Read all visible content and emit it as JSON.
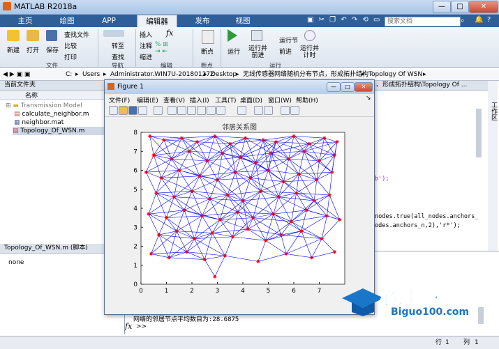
{
  "window": {
    "title": "MATLAB R2018a",
    "minimize": "—",
    "maximize": "□",
    "close": "✕"
  },
  "tabs": [
    {
      "label": "主页"
    },
    {
      "label": "绘图"
    },
    {
      "label": "APP"
    },
    {
      "label": "编辑器"
    },
    {
      "label": "发布"
    },
    {
      "label": "视图"
    }
  ],
  "search": {
    "placeholder": "搜索文档"
  },
  "ribbon": {
    "new": "新建",
    "open": "打开",
    "save": "保存",
    "find_files": "查找文件",
    "compare": "比较",
    "print": "打印",
    "goto": "转至",
    "find": "查找",
    "insert": "插入",
    "comment": "注释",
    "indent": "缩进",
    "fx": "fx",
    "breakpoints": "断点",
    "run": "运行",
    "run_advance": "运行并\n前进",
    "run_section": "运行节",
    "advance": "前进",
    "run_time": "运行并\n计时",
    "groups": {
      "file": "文件",
      "navigate": "导航",
      "edit": "编辑",
      "breakpoints": "断点",
      "run": "运行"
    }
  },
  "address": {
    "path": [
      "C:",
      "Users",
      "Administrator.WIN7U-20180127Z",
      "Desktop",
      "无线传感器网络随机分布节点，形成拓扑结构",
      "Topology Of WSN"
    ]
  },
  "current_folder": {
    "header": "当前文件夹",
    "column": "名称",
    "items": [
      {
        "name": "Transmission Model",
        "type": "folder"
      },
      {
        "name": "calculate_neighbor.m",
        "type": "m"
      },
      {
        "name": "neighbor.mat",
        "type": "mat"
      },
      {
        "name": "Topology_Of_WSN.m",
        "type": "m",
        "selected": true
      }
    ]
  },
  "details": {
    "header": "Topology_Of_WSN.m  (脚本)",
    "content": "none"
  },
  "editor": {
    "tab_path": "、形成拓扑结构\\Topology Of ...",
    "line1": "b');",
    "line2": "nodes.true(all_nodes.anchors_",
    "line3": "odes.anchors_n,2),'r*');"
  },
  "workspace_label": "工作区",
  "command": {
    "output": "网络的邻居节点平均数目为:28.6875",
    "prompt": ">>",
    "fx": "fx"
  },
  "status": {
    "row_label": "行",
    "row": "1",
    "col_label": "列",
    "col": "1"
  },
  "figure": {
    "title": "Figure 1",
    "menu": [
      "文件(F)",
      "编辑(E)",
      "查看(V)",
      "插入(I)",
      "工具(T)",
      "桌面(D)",
      "窗口(W)",
      "帮助(H)"
    ]
  },
  "watermark": {
    "text": "必过源码",
    "url": "Biguo100.com"
  },
  "colors": {
    "edge": "#0000ff",
    "node": "#ff0000",
    "tabbar": "#2f5f99"
  },
  "chart_data": {
    "type": "scatter",
    "title": "邻居关系图",
    "xlim": [
      0,
      8
    ],
    "ylim": [
      0,
      8
    ],
    "xticks": [
      0,
      1,
      2,
      3,
      4,
      5,
      6,
      7
    ],
    "yticks": [
      0,
      1,
      2,
      3,
      4,
      5,
      6,
      7,
      8
    ],
    "x": [
      0.35,
      0.9,
      1.6,
      2.2,
      2.9,
      3.5,
      4.1,
      4.8,
      5.3,
      6.0,
      6.6,
      7.2,
      7.7,
      0.5,
      1.2,
      1.9,
      2.6,
      3.2,
      3.9,
      4.5,
      5.1,
      5.8,
      6.4,
      7.0,
      7.6,
      0.2,
      0.8,
      1.5,
      2.3,
      3.0,
      3.7,
      4.3,
      5.0,
      5.6,
      6.2,
      6.9,
      7.5,
      0.6,
      1.3,
      2.0,
      2.7,
      3.4,
      4.0,
      4.7,
      5.4,
      6.1,
      6.8,
      7.4,
      0.3,
      1.0,
      1.7,
      2.4,
      3.1,
      3.8,
      4.4,
      5.2,
      5.9,
      6.5,
      7.3,
      7.8,
      0.7,
      1.4,
      2.1,
      2.8,
      3.6,
      4.2,
      4.9,
      5.5,
      6.3,
      7.1,
      0.4,
      1.1,
      1.8,
      2.5,
      3.3,
      4.6,
      5.7,
      6.7,
      7.6,
      2.9
    ],
    "y": [
      7.8,
      7.6,
      7.7,
      7.5,
      7.8,
      7.4,
      7.7,
      7.6,
      7.5,
      7.8,
      7.4,
      7.7,
      7.5,
      6.8,
      6.6,
      7.0,
      6.5,
      6.9,
      6.7,
      6.4,
      6.9,
      6.6,
      7.0,
      6.5,
      6.8,
      5.9,
      5.6,
      6.0,
      5.7,
      5.5,
      5.9,
      5.6,
      6.0,
      5.4,
      5.8,
      5.5,
      5.9,
      4.8,
      4.6,
      4.9,
      4.5,
      4.7,
      4.4,
      4.9,
      4.6,
      4.8,
      4.4,
      4.7,
      3.7,
      3.5,
      3.9,
      3.6,
      3.4,
      3.8,
      3.5,
      3.7,
      3.3,
      3.9,
      3.6,
      3.4,
      2.6,
      2.8,
      2.4,
      2.7,
      2.5,
      2.9,
      2.3,
      2.6,
      2.8,
      2.4,
      1.6,
      1.4,
      1.7,
      1.3,
      1.5,
      1.2,
      1.6,
      1.4,
      1.7,
      0.4
    ]
  }
}
